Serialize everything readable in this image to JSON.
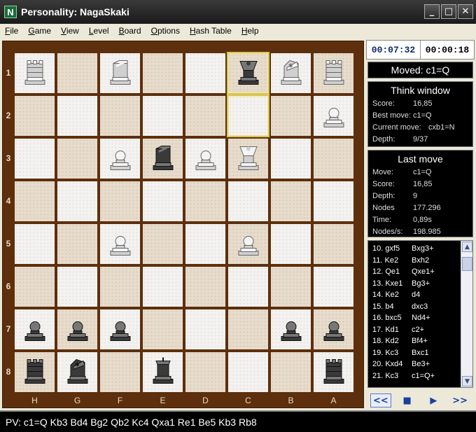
{
  "window": {
    "title": "Personality: NagaSkaki",
    "app_icon": "N"
  },
  "menu": [
    "File",
    "Game",
    "View",
    "Level",
    "Board",
    "Options",
    "Hash Table",
    "Help"
  ],
  "clocks": {
    "white": "00:07:32",
    "black": "00:00:18"
  },
  "moved": "Moved: c1=Q",
  "think": {
    "title": "Think window",
    "rows": [
      {
        "k": "Score:",
        "v": "16,85"
      },
      {
        "k": "Best move:",
        "v": "c1=Q"
      },
      {
        "k": "Current move:",
        "v": "cxb1=N"
      },
      {
        "k": "Depth:",
        "v": "9/37"
      }
    ]
  },
  "last": {
    "title": "Last move",
    "rows": [
      {
        "k": "Move:",
        "v": "c1=Q"
      },
      {
        "k": "Score:",
        "v": "16,85"
      },
      {
        "k": "Depth:",
        "v": "9"
      },
      {
        "k": "Nodes",
        "v": "177.296"
      },
      {
        "k": "Time:",
        "v": "0,89s"
      },
      {
        "k": "Nodes/s:",
        "v": "198.985"
      }
    ]
  },
  "moves": [
    {
      "w": "10. gxf5",
      "b": "Bxg3+"
    },
    {
      "w": "11. Ke2",
      "b": "Bxh2"
    },
    {
      "w": "12. Qe1",
      "b": "Qxe1+"
    },
    {
      "w": "13. Kxe1",
      "b": "Bg3+"
    },
    {
      "w": "14. Ke2",
      "b": "d4"
    },
    {
      "w": "15. b4",
      "b": "dxc3"
    },
    {
      "w": "16. bxc5",
      "b": "Nd4+"
    },
    {
      "w": "17. Kd1",
      "b": "c2+"
    },
    {
      "w": "18. Kd2",
      "b": "Bf4+"
    },
    {
      "w": "19. Kc3",
      "b": "Bxc1"
    },
    {
      "w": "20. Kxd4",
      "b": "Be3+"
    },
    {
      "w": "21. Kc3",
      "b": "c1=Q+"
    }
  ],
  "nav": {
    "first": "<<",
    "stop": "■",
    "play": "▶",
    "last": ">>"
  },
  "ranks": [
    "1",
    "2",
    "3",
    "4",
    "5",
    "6",
    "7",
    "8"
  ],
  "files": [
    "H",
    "G",
    "F",
    "E",
    "D",
    "C",
    "B",
    "A"
  ],
  "board": [
    [
      "wR",
      "",
      "wB",
      "",
      "",
      "bQ",
      "wN",
      "wR"
    ],
    [
      "",
      "",
      "",
      "",
      "",
      "",
      "",
      "wP"
    ],
    [
      "",
      "",
      "wP",
      "bB",
      "wP",
      "wQ",
      "",
      ""
    ],
    [
      "",
      "",
      "",
      "",
      "",
      "",
      "",
      ""
    ],
    [
      "",
      "",
      "wP",
      "",
      "",
      "wP",
      "",
      ""
    ],
    [
      "",
      "",
      "",
      "",
      "",
      "",
      "",
      ""
    ],
    [
      "bP",
      "bP",
      "bP",
      "",
      "",
      "",
      "bP",
      "bP"
    ],
    [
      "bR",
      "bN",
      "",
      "bK",
      "",
      "",
      "",
      "bR"
    ]
  ],
  "highlight": [
    "0-5",
    "1-5"
  ],
  "status": "PV: c1=Q Kb3 Bd4 Bg2 Qb2 Kc4 Qxa1 Re1 Be5 Kb3 Rb8",
  "colors": {
    "board_border": "#5e2f0c",
    "white_piece": "#d0d0d0",
    "black_piece": "#3a3a3a",
    "highlight": "#d8c55a"
  }
}
